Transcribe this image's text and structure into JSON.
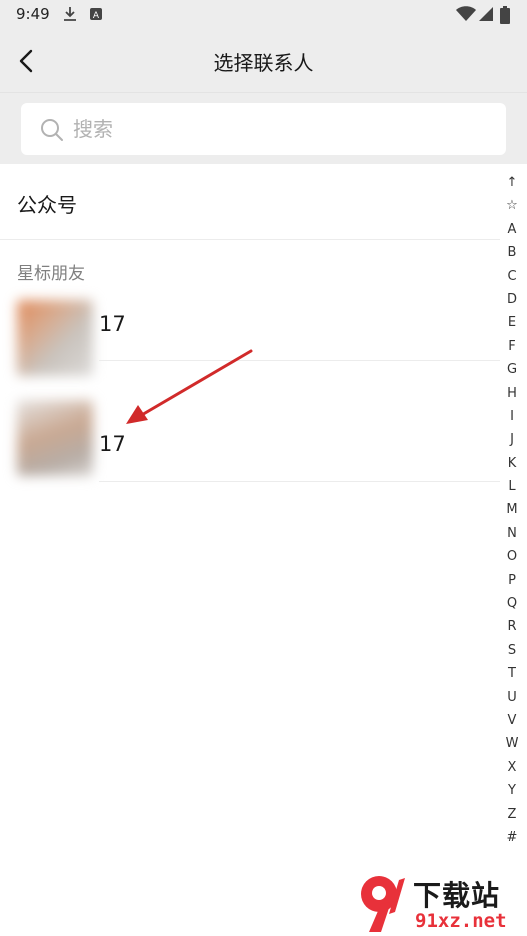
{
  "status_bar": {
    "time": "9:49",
    "icons": [
      "download-icon",
      "a-notification-icon",
      "wifi-icon",
      "signal-icon",
      "battery-icon"
    ]
  },
  "header": {
    "title": "选择联系人",
    "back_icon": "chevron-left-icon"
  },
  "search": {
    "placeholder": "搜索",
    "value": ""
  },
  "official_accounts": {
    "label": "公众号"
  },
  "starred": {
    "title": "星标朋友",
    "contacts": [
      {
        "name": "17"
      },
      {
        "name": "17"
      }
    ]
  },
  "index_bar": {
    "letters": [
      "↑",
      "☆",
      "A",
      "B",
      "C",
      "D",
      "E",
      "F",
      "G",
      "H",
      "I",
      "J",
      "K",
      "L",
      "M",
      "N",
      "O",
      "P",
      "Q",
      "R",
      "S",
      "T",
      "U",
      "V",
      "W",
      "X",
      "Y",
      "Z",
      "#"
    ]
  },
  "watermark": {
    "title": "下载站",
    "url": "91xz.net",
    "logo": "9"
  },
  "colors": {
    "header_bg": "#ededed",
    "arrow": "#d12a2a",
    "watermark_red": "#e8313a"
  }
}
